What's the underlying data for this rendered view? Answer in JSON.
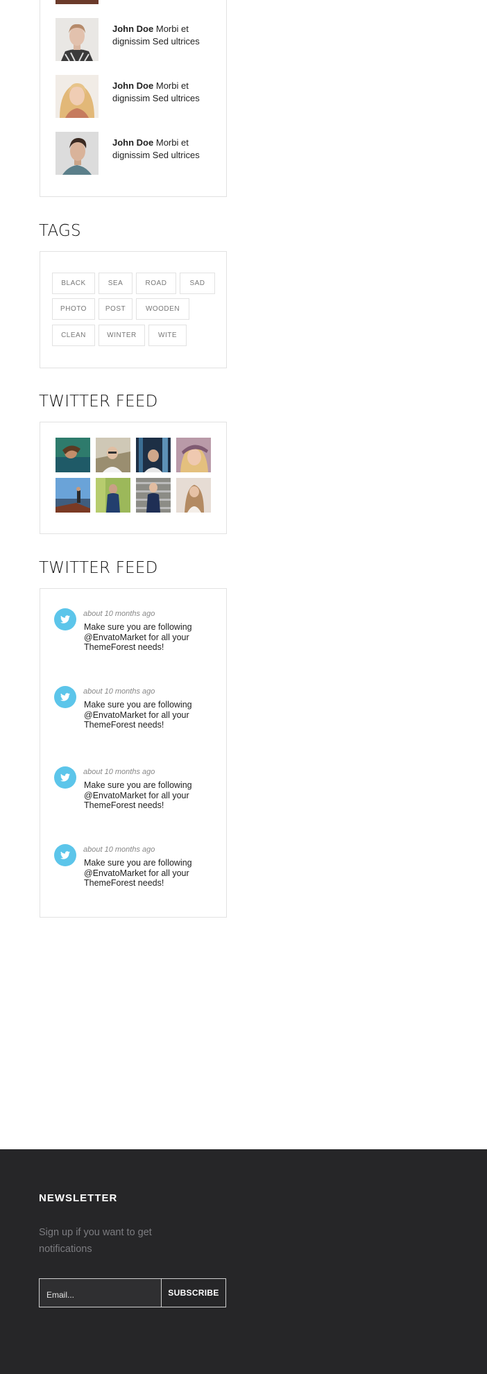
{
  "recent_comments": [
    {
      "author": "John Doe",
      "text": "Morbi et dignissim Sed ultrices"
    },
    {
      "author": "John Doe",
      "text": "Morbi et dignissim Sed ultrices"
    },
    {
      "author": "John Doe",
      "text": "Morbi et dignissim Sed ultrices"
    }
  ],
  "tags": {
    "title": "TAGS",
    "items": [
      "BLACK",
      "SEA",
      "ROAD",
      "SAD",
      "PHOTO",
      "POST",
      "WOODEN",
      "CLEAN",
      "WINTER",
      "WITE"
    ]
  },
  "twitter_gallery": {
    "title": "TWITTER FEED"
  },
  "twitter_feed": {
    "title": "TWITTER FEED",
    "tweets": [
      {
        "time": "about 10 months ago",
        "text": "Make sure you are following @EnvatoMarket for all your ThemeForest needs!"
      },
      {
        "time": "about 10 months ago",
        "text": "Make sure you are following @EnvatoMarket for all your ThemeForest needs!"
      },
      {
        "time": "about 10 months ago",
        "text": "Make sure you are following @EnvatoMarket for all your ThemeForest needs!"
      },
      {
        "time": "about 10 months ago",
        "text": "Make sure you are following @EnvatoMarket for all your ThemeForest needs!"
      }
    ]
  },
  "newsletter": {
    "title": "NEWSLETTER",
    "description": "Sign up if you want to get notifications",
    "email_placeholder": "Email...",
    "subscribe_label": "SUBSCRIBE"
  },
  "colors": {
    "twitter_blue": "#5cc5ea",
    "footer_bg": "#262628",
    "border": "#e2e2e2"
  }
}
